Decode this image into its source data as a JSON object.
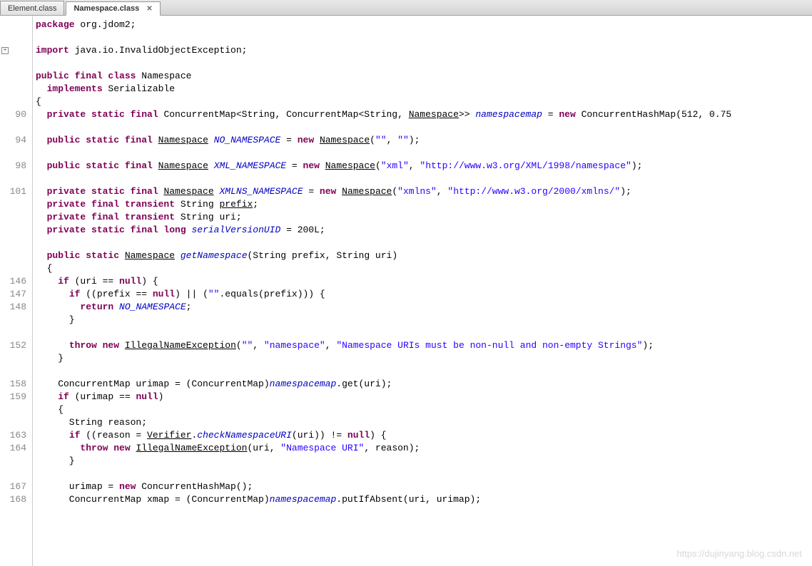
{
  "tabs": [
    {
      "label": "Element.class",
      "active": false,
      "closable": false
    },
    {
      "label": "Namespace.class",
      "active": true,
      "closable": true
    }
  ],
  "watermark": "https://dujinyang.blog.csdn.net",
  "gutter": [
    "",
    "",
    "",
    "",
    "",
    "",
    "",
    "90",
    "",
    "94",
    "",
    "98",
    "",
    "101",
    "",
    "",
    "",
    "",
    "",
    "",
    "146",
    "147",
    "148",
    "",
    "",
    "152",
    "",
    "",
    "158",
    "159",
    "",
    "",
    "163",
    "164",
    "",
    "",
    "167",
    "168"
  ],
  "code": {
    "l0": {
      "pre": "",
      "kw1": "package",
      "t1": " org.jdom2;"
    },
    "l1": "",
    "l2": {
      "pre": "",
      "kw1": "import",
      "t1": " java.io.InvalidObjectException;",
      "expand": true
    },
    "l3": "",
    "l4": {
      "pre": "",
      "kw1": "public final class",
      "t1": " Namespace"
    },
    "l5": {
      "pre": "  ",
      "kw1": "implements",
      "t1": " Serializable"
    },
    "l6": {
      "pre": "{"
    },
    "l7": {
      "pre": "  ",
      "kw1": "private static final",
      "t1": " ConcurrentMap<String, ConcurrentMap<String, ",
      "u1": "Namespace",
      "t2": ">> ",
      "fi1": "namespacemap",
      "t3": " = ",
      "kw2": "new",
      "t4": " ConcurrentHashMap(512, 0.75"
    },
    "l8": "",
    "l9": {
      "pre": "  ",
      "kw1": "public static final",
      "t1": " ",
      "u1": "Namespace",
      "t2": " ",
      "fi1": "NO_NAMESPACE",
      "t3": " = ",
      "kw2": "new",
      "t4": " ",
      "u2": "Namespace",
      "t5": "(",
      "s1": "\"\"",
      "t6": ", ",
      "s2": "\"\"",
      "t7": ");"
    },
    "l10": "",
    "l11": {
      "pre": "  ",
      "kw1": "public static final",
      "t1": " ",
      "u1": "Namespace",
      "t2": " ",
      "fi1": "XML_NAMESPACE",
      "t3": " = ",
      "kw2": "new",
      "t4": " ",
      "u2": "Namespace",
      "t5": "(",
      "s1": "\"xml\"",
      "t6": ", ",
      "s2": "\"http://www.w3.org/XML/1998/namespace\"",
      "t7": ");"
    },
    "l12": "",
    "l13": {
      "pre": "  ",
      "kw1": "private static final",
      "t1": " ",
      "u1": "Namespace",
      "t2": " ",
      "fi1": "XMLNS_NAMESPACE",
      "t3": " = ",
      "kw2": "new",
      "t4": " ",
      "u2": "Namespace",
      "t5": "(",
      "s1": "\"xmlns\"",
      "t6": ", ",
      "s2": "\"http://www.w3.org/2000/xmlns/\"",
      "t7": ");"
    },
    "l14": {
      "pre": "  ",
      "kw1": "private final transient",
      "t1": " String ",
      "u1": "prefix",
      "t2": ";"
    },
    "l15": {
      "pre": "  ",
      "kw1": "private final transient",
      "t1": " String uri;"
    },
    "l16": {
      "pre": "  ",
      "kw1": "private static final long",
      "t1": " ",
      "fi1": "serialVersionUID",
      "t2": " = 200L;"
    },
    "l17": "",
    "l18": {
      "pre": "  ",
      "kw1": "public static",
      "t1": " ",
      "u1": "Namespace",
      "t2": " ",
      "fi1": "getNamespace",
      "t3": "(String prefix, String uri)"
    },
    "l19": {
      "pre": "  {"
    },
    "l20": {
      "pre": "    ",
      "kw1": "if",
      "t1": " (uri == ",
      "kw2": "null",
      "t2": ") {"
    },
    "l21": {
      "pre": "      ",
      "kw1": "if",
      "t1": " ((prefix == ",
      "kw2": "null",
      "t2": ") || (",
      "s1": "\"\"",
      "t3": ".equals(prefix))) {"
    },
    "l22": {
      "pre": "        ",
      "kw1": "return",
      "t1": " ",
      "fi1": "NO_NAMESPACE",
      "t2": ";"
    },
    "l23": {
      "pre": "      }"
    },
    "l24": "",
    "l25": {
      "pre": "      ",
      "kw1": "throw new",
      "t1": " ",
      "u1": "IllegalNameException",
      "t2": "(",
      "s1": "\"\"",
      "t3": ", ",
      "s2": "\"namespace\"",
      "t4": ", ",
      "s3": "\"Namespace URIs must be non-null and non-empty Strings\"",
      "t5": ");"
    },
    "l26": {
      "pre": "    }"
    },
    "l27": "",
    "l28": {
      "pre": "    ConcurrentMap urimap = (ConcurrentMap)",
      "fi1": "namespacemap",
      "t1": ".get(uri);"
    },
    "l29": {
      "pre": "    ",
      "kw1": "if",
      "t1": " (urimap == ",
      "kw2": "null",
      "t2": ")"
    },
    "l30": {
      "pre": "    {"
    },
    "l31": {
      "pre": "      String reason;"
    },
    "l32": {
      "pre": "      ",
      "kw1": "if",
      "t1": " ((reason = ",
      "u1": "Verifier",
      "t2": ".",
      "fi1": "checkNamespaceURI",
      "t3": "(uri)) != ",
      "kw2": "null",
      "t4": ") {"
    },
    "l33": {
      "pre": "        ",
      "kw1": "throw new",
      "t1": " ",
      "u1": "IllegalNameException",
      "t2": "(uri, ",
      "s1": "\"Namespace URI\"",
      "t3": ", reason);"
    },
    "l34": {
      "pre": "      }"
    },
    "l35": "",
    "l36": {
      "pre": "      urimap = ",
      "kw1": "new",
      "t1": " ConcurrentHashMap();"
    },
    "l37": {
      "pre": "      ConcurrentMap xmap = (ConcurrentMap)",
      "fi1": "namespacemap",
      "t1": ".putIfAbsent(uri, urimap);"
    }
  }
}
